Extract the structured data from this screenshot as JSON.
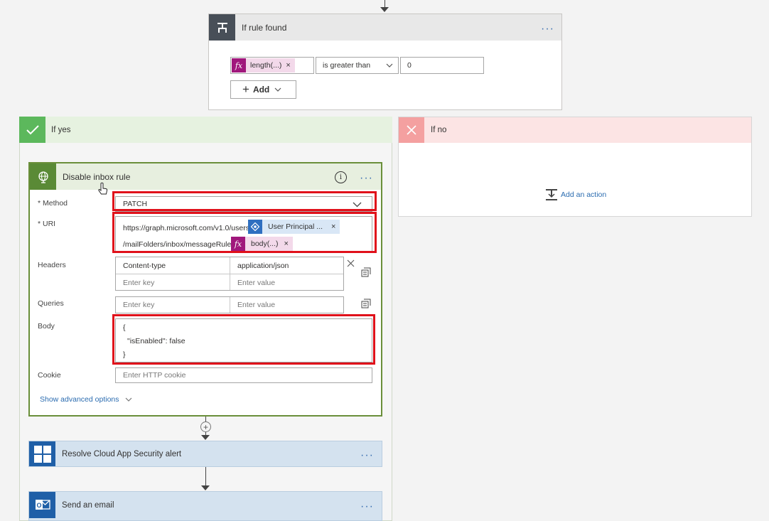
{
  "condition_card": {
    "title": "If rule found",
    "token": {
      "label": "length(...)",
      "close": "×"
    },
    "operator": "is greater than",
    "value": "0",
    "add_label": "Add"
  },
  "if_yes": {
    "title": "If yes"
  },
  "if_no": {
    "title": "If no",
    "add_action": "Add an action"
  },
  "http_card": {
    "title": "Disable inbox rule",
    "method_label": "* Method",
    "method_value": "PATCH",
    "uri_label": "* URI",
    "uri_line1": "https://graph.microsoft.com/v1.0/users/",
    "uri_token1": "User Principal ...",
    "uri_line2": "/mailFolders/inbox/messageRules/",
    "uri_token2": "body(...)",
    "token_close": "×",
    "headers_label": "Headers",
    "header_key": "Content-type",
    "header_value": "application/json",
    "key_placeholder": "Enter key",
    "value_placeholder": "Enter value",
    "queries_label": "Queries",
    "body_label": "Body",
    "body_line1": "{",
    "body_line2": "\"isEnabled\": false",
    "body_line3": "}",
    "cookie_label": "Cookie",
    "cookie_placeholder": "Enter HTTP cookie",
    "advanced": "Show advanced options"
  },
  "resolve_card": {
    "title": "Resolve Cloud App Security alert"
  },
  "email_card": {
    "title": "Send an email"
  },
  "colors": {
    "condition_icon": "#484f58",
    "yes_bg": "#e6f2e0",
    "yes_icon": "#5cb85c",
    "no_bg": "#fce4e4",
    "no_icon": "#f4a0a0",
    "http_head": "#e7efdf",
    "http_icon": "#5a8a36",
    "fx_token": "#a0177c",
    "token_bg": "#f3d9ea",
    "user_token_bg": "#d9e7f6",
    "user_token_icon": "#2f6fc0",
    "mcas_head": "#d4e2ef",
    "mcas_icon": "#1f5fa7",
    "red": "#e0111b"
  }
}
